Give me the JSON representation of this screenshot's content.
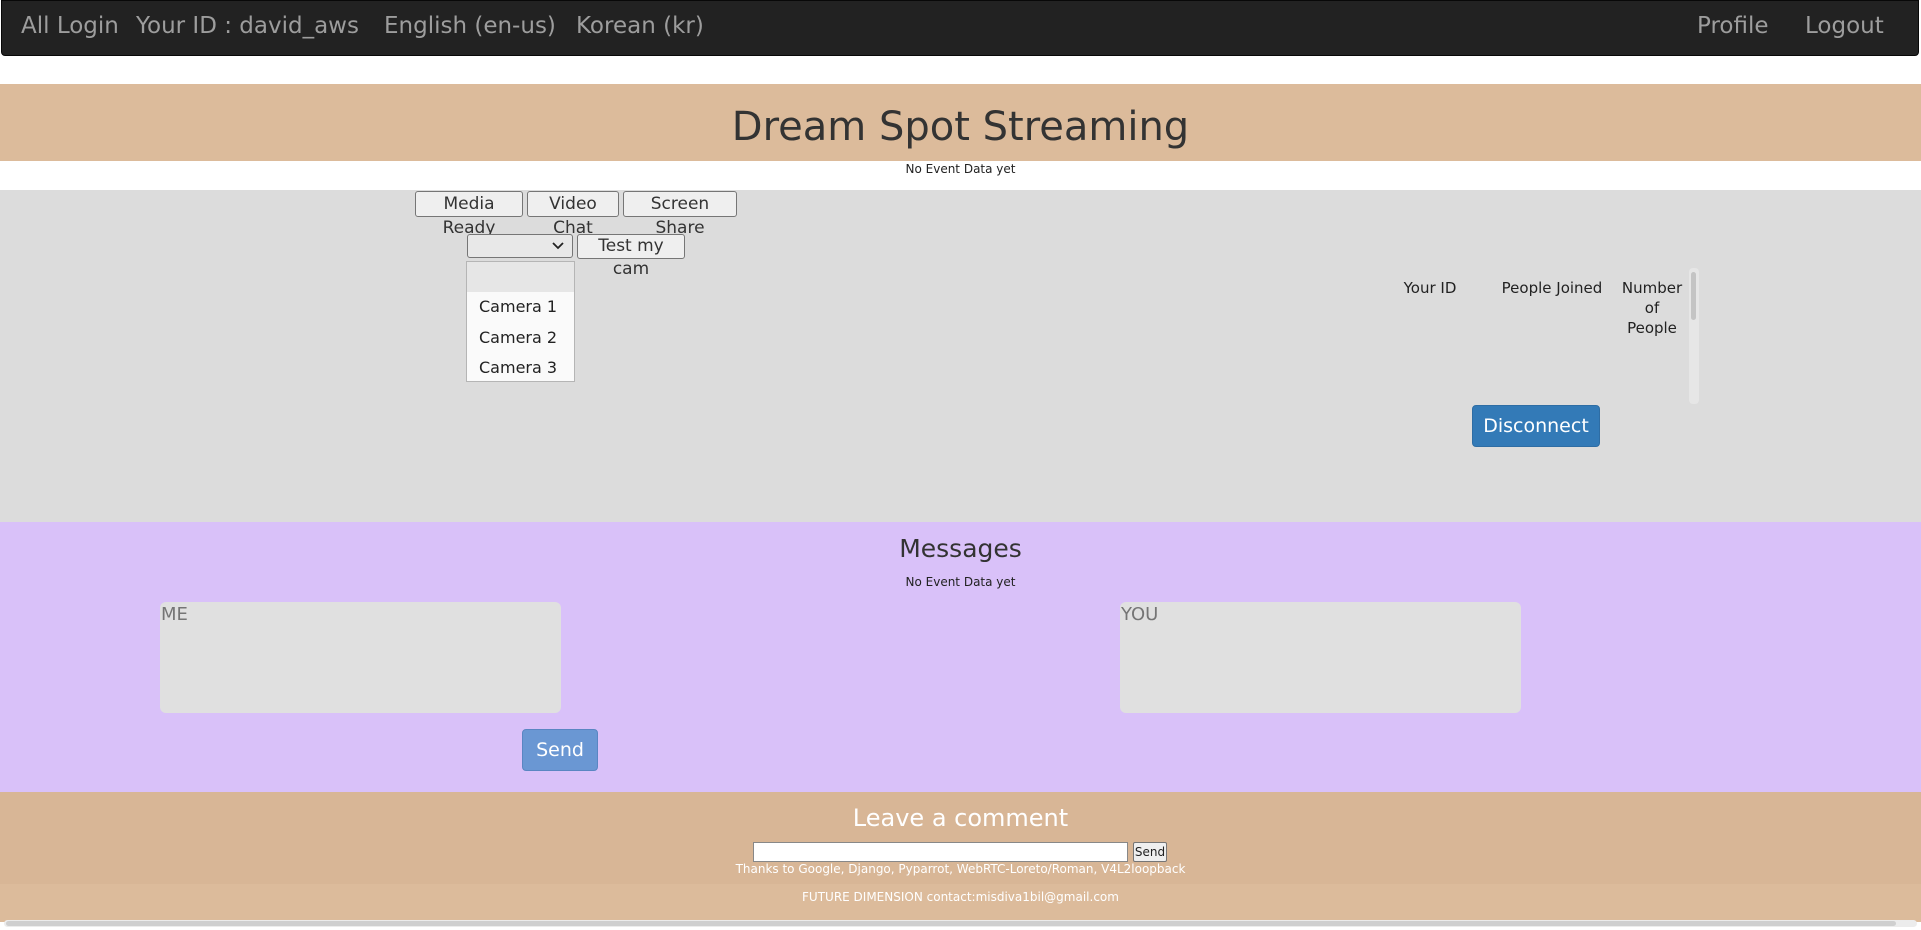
{
  "nav": {
    "all_login": "All Login",
    "your_id": "Your ID : david_aws",
    "english": "English (en-us)",
    "korean": "Korean (kr)",
    "profile": "Profile",
    "logout": "Logout"
  },
  "header": {
    "title": "Dream Spot Streaming",
    "event_status": "No Event Data yet"
  },
  "controls": {
    "media_ready": "Media Ready",
    "video_chat": "Video Chat",
    "screen_share": "Screen Share",
    "test_cam": "Test my cam",
    "camera_select": {
      "selected": "",
      "options": [
        "Camera 1",
        "Camera 2",
        "Camera 3"
      ]
    }
  },
  "table": {
    "headers": [
      "Your ID",
      "People Joined",
      "Number of People"
    ]
  },
  "disconnect": "Disconnect",
  "messages": {
    "title": "Messages",
    "event_status": "No Event Data yet",
    "me_placeholder": "ME",
    "you_placeholder": "YOU",
    "send": "Send"
  },
  "comment": {
    "title": "Leave a comment",
    "send": "Send",
    "thanks": "Thanks to Google, Django, Pyparrot, WebRTC-Loreto/Roman, V4L2loopback"
  },
  "footer": {
    "text": "FUTURE DIMENSION contact:misdiva1bil@gmail.com"
  },
  "colors": {
    "navbar": "#222222",
    "header_band": "#dcbb9b",
    "stage": "#dcdcdc",
    "messages": "#d9c1f9",
    "comment": "#d8b696",
    "primary": "#337ab7"
  }
}
